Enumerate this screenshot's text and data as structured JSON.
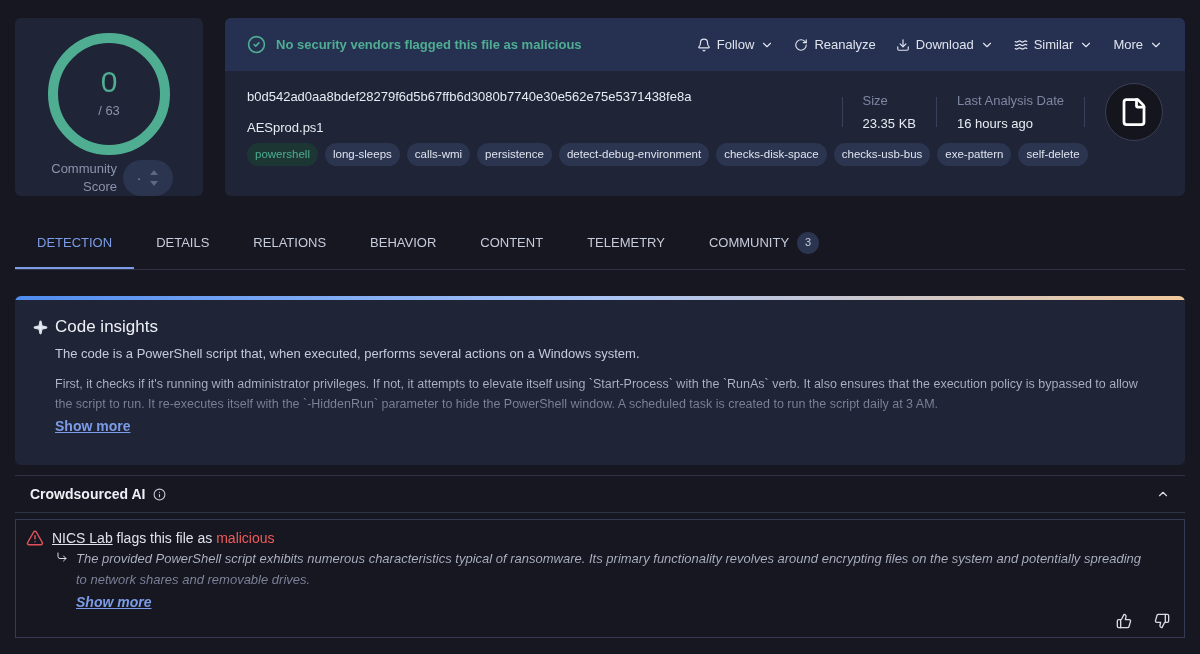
{
  "score": {
    "detections": "0",
    "total": "/ 63",
    "community_label": "Community Score",
    "community_value": "·"
  },
  "verdict": "No security vendors flagged this file as malicious",
  "actions": [
    {
      "label": "Follow",
      "dropdown": true
    },
    {
      "label": "Reanalyze",
      "dropdown": false
    },
    {
      "label": "Download",
      "dropdown": true
    },
    {
      "label": "Similar",
      "dropdown": true
    },
    {
      "label": "More",
      "dropdown": true
    }
  ],
  "file": {
    "hash": "b0d542ad0aa8bdef28279f6d5b67ffb6d3080b7740e30e562e75e5371438fe8a",
    "name": "AESprod.ps1"
  },
  "tags": [
    {
      "label": "powershell",
      "kind": "language"
    },
    {
      "label": "long-sleeps",
      "kind": "tag"
    },
    {
      "label": "calls-wmi",
      "kind": "tag"
    },
    {
      "label": "persistence",
      "kind": "tag"
    },
    {
      "label": "detect-debug-environment",
      "kind": "tag"
    },
    {
      "label": "checks-disk-space",
      "kind": "tag"
    },
    {
      "label": "checks-usb-bus",
      "kind": "tag"
    },
    {
      "label": "exe-pattern",
      "kind": "tag"
    },
    {
      "label": "self-delete",
      "kind": "tag"
    }
  ],
  "stats": [
    {
      "label": "Size",
      "value": "23.35 KB"
    },
    {
      "label": "Last Analysis Date",
      "value": "16 hours ago"
    }
  ],
  "tabs": [
    {
      "label": "DETECTION",
      "selected": true
    },
    {
      "label": "DETAILS",
      "selected": false
    },
    {
      "label": "RELATIONS",
      "selected": false
    },
    {
      "label": "BEHAVIOR",
      "selected": false
    },
    {
      "label": "CONTENT",
      "selected": false
    },
    {
      "label": "TELEMETRY",
      "selected": false
    },
    {
      "label": "COMMUNITY",
      "selected": false,
      "count": "3"
    }
  ],
  "code_insights": {
    "title": "Code insights",
    "paragraphs": [
      "The code is a PowerShell script that, when executed, performs several actions on a Windows system.",
      "First, it checks if it's running with administrator privileges. If not, it attempts to elevate itself using `Start-Process` with the `RunAs` verb. It also ensures that the execution policy is bypassed to allow the script to run. It re-executes itself with the `-HiddenRun` parameter to hide the PowerShell window. A scheduled task is created to run the script daily at 3 AM."
    ],
    "show_more": "Show more"
  },
  "crowdsourced": {
    "title": "Crowdsourced AI",
    "expanded": true,
    "entries": [
      {
        "source": "NICS Lab",
        "middle": "flags this file as",
        "verdict": "malicious",
        "summary": "The provided PowerShell script exhibits numerous characteristics typical of ransomware. Its primary functionality revolves around encrypting files on the system and potentially spreading to network shares and removable drives.",
        "show_more": "Show more"
      }
    ]
  }
}
